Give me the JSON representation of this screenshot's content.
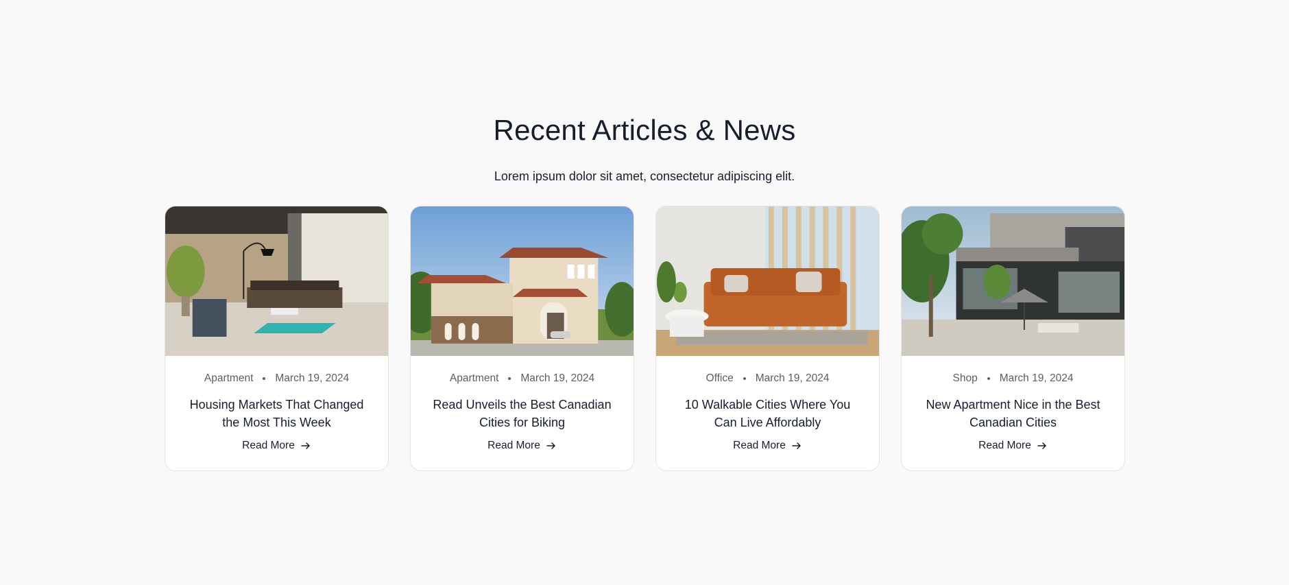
{
  "section": {
    "heading": "Recent Articles & News",
    "subtitle": "Lorem ipsum dolor sit amet, consectetur adipiscing elit."
  },
  "articles": [
    {
      "category": "Apartment",
      "date": "March 19, 2024",
      "title": "Housing Markets That Changed the Most This Week",
      "read_more": "Read More",
      "image": "living-room-interior"
    },
    {
      "category": "Apartment",
      "date": "March 19, 2024",
      "title": "Read Unveils the Best Canadian Cities for Biking",
      "read_more": "Read More",
      "image": "mansion-exterior"
    },
    {
      "category": "Office",
      "date": "March 19, 2024",
      "title": "10 Walkable Cities Where You Can Live Affordably",
      "read_more": "Read More",
      "image": "orange-sofa-room"
    },
    {
      "category": "Shop",
      "date": "March 19, 2024",
      "title": "New Apartment Nice in the Best Canadian Cities",
      "read_more": "Read More",
      "image": "modern-house-patio"
    }
  ],
  "colors": {
    "background": "#f9f9f9",
    "text": "#161e2d",
    "muted": "#5c5e61",
    "card_border": "#e4e4e4"
  }
}
